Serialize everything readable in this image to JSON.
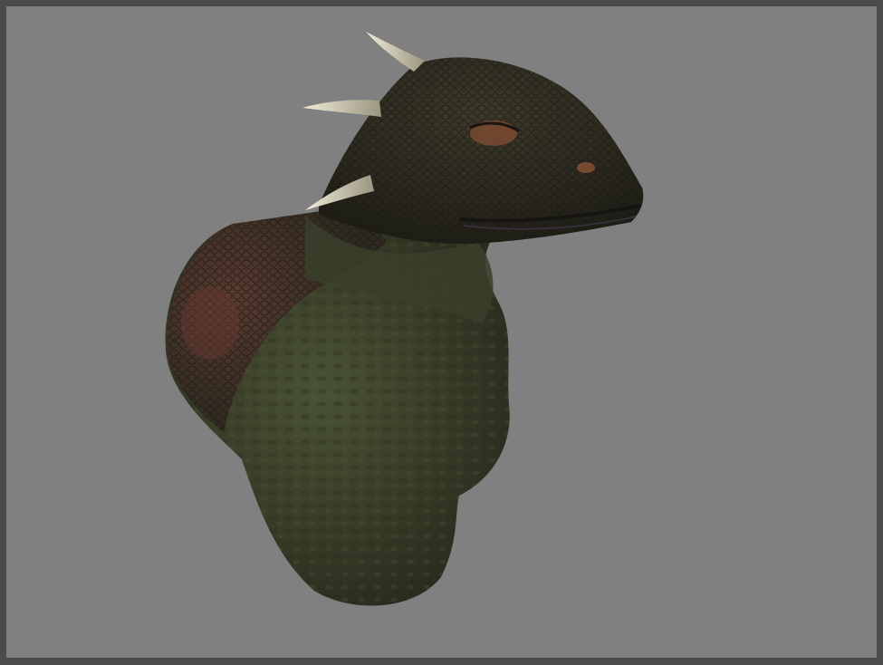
{
  "viewport": {
    "background_color": "#808080",
    "frame_color": "#4b4b4b"
  },
  "model": {
    "subject": "lizard-creature-bust",
    "skin_color": "#3a3f2a",
    "scale_color": "#2f2a1f",
    "horn_color": "#d8d4c0",
    "eye_color": "#b07040"
  }
}
